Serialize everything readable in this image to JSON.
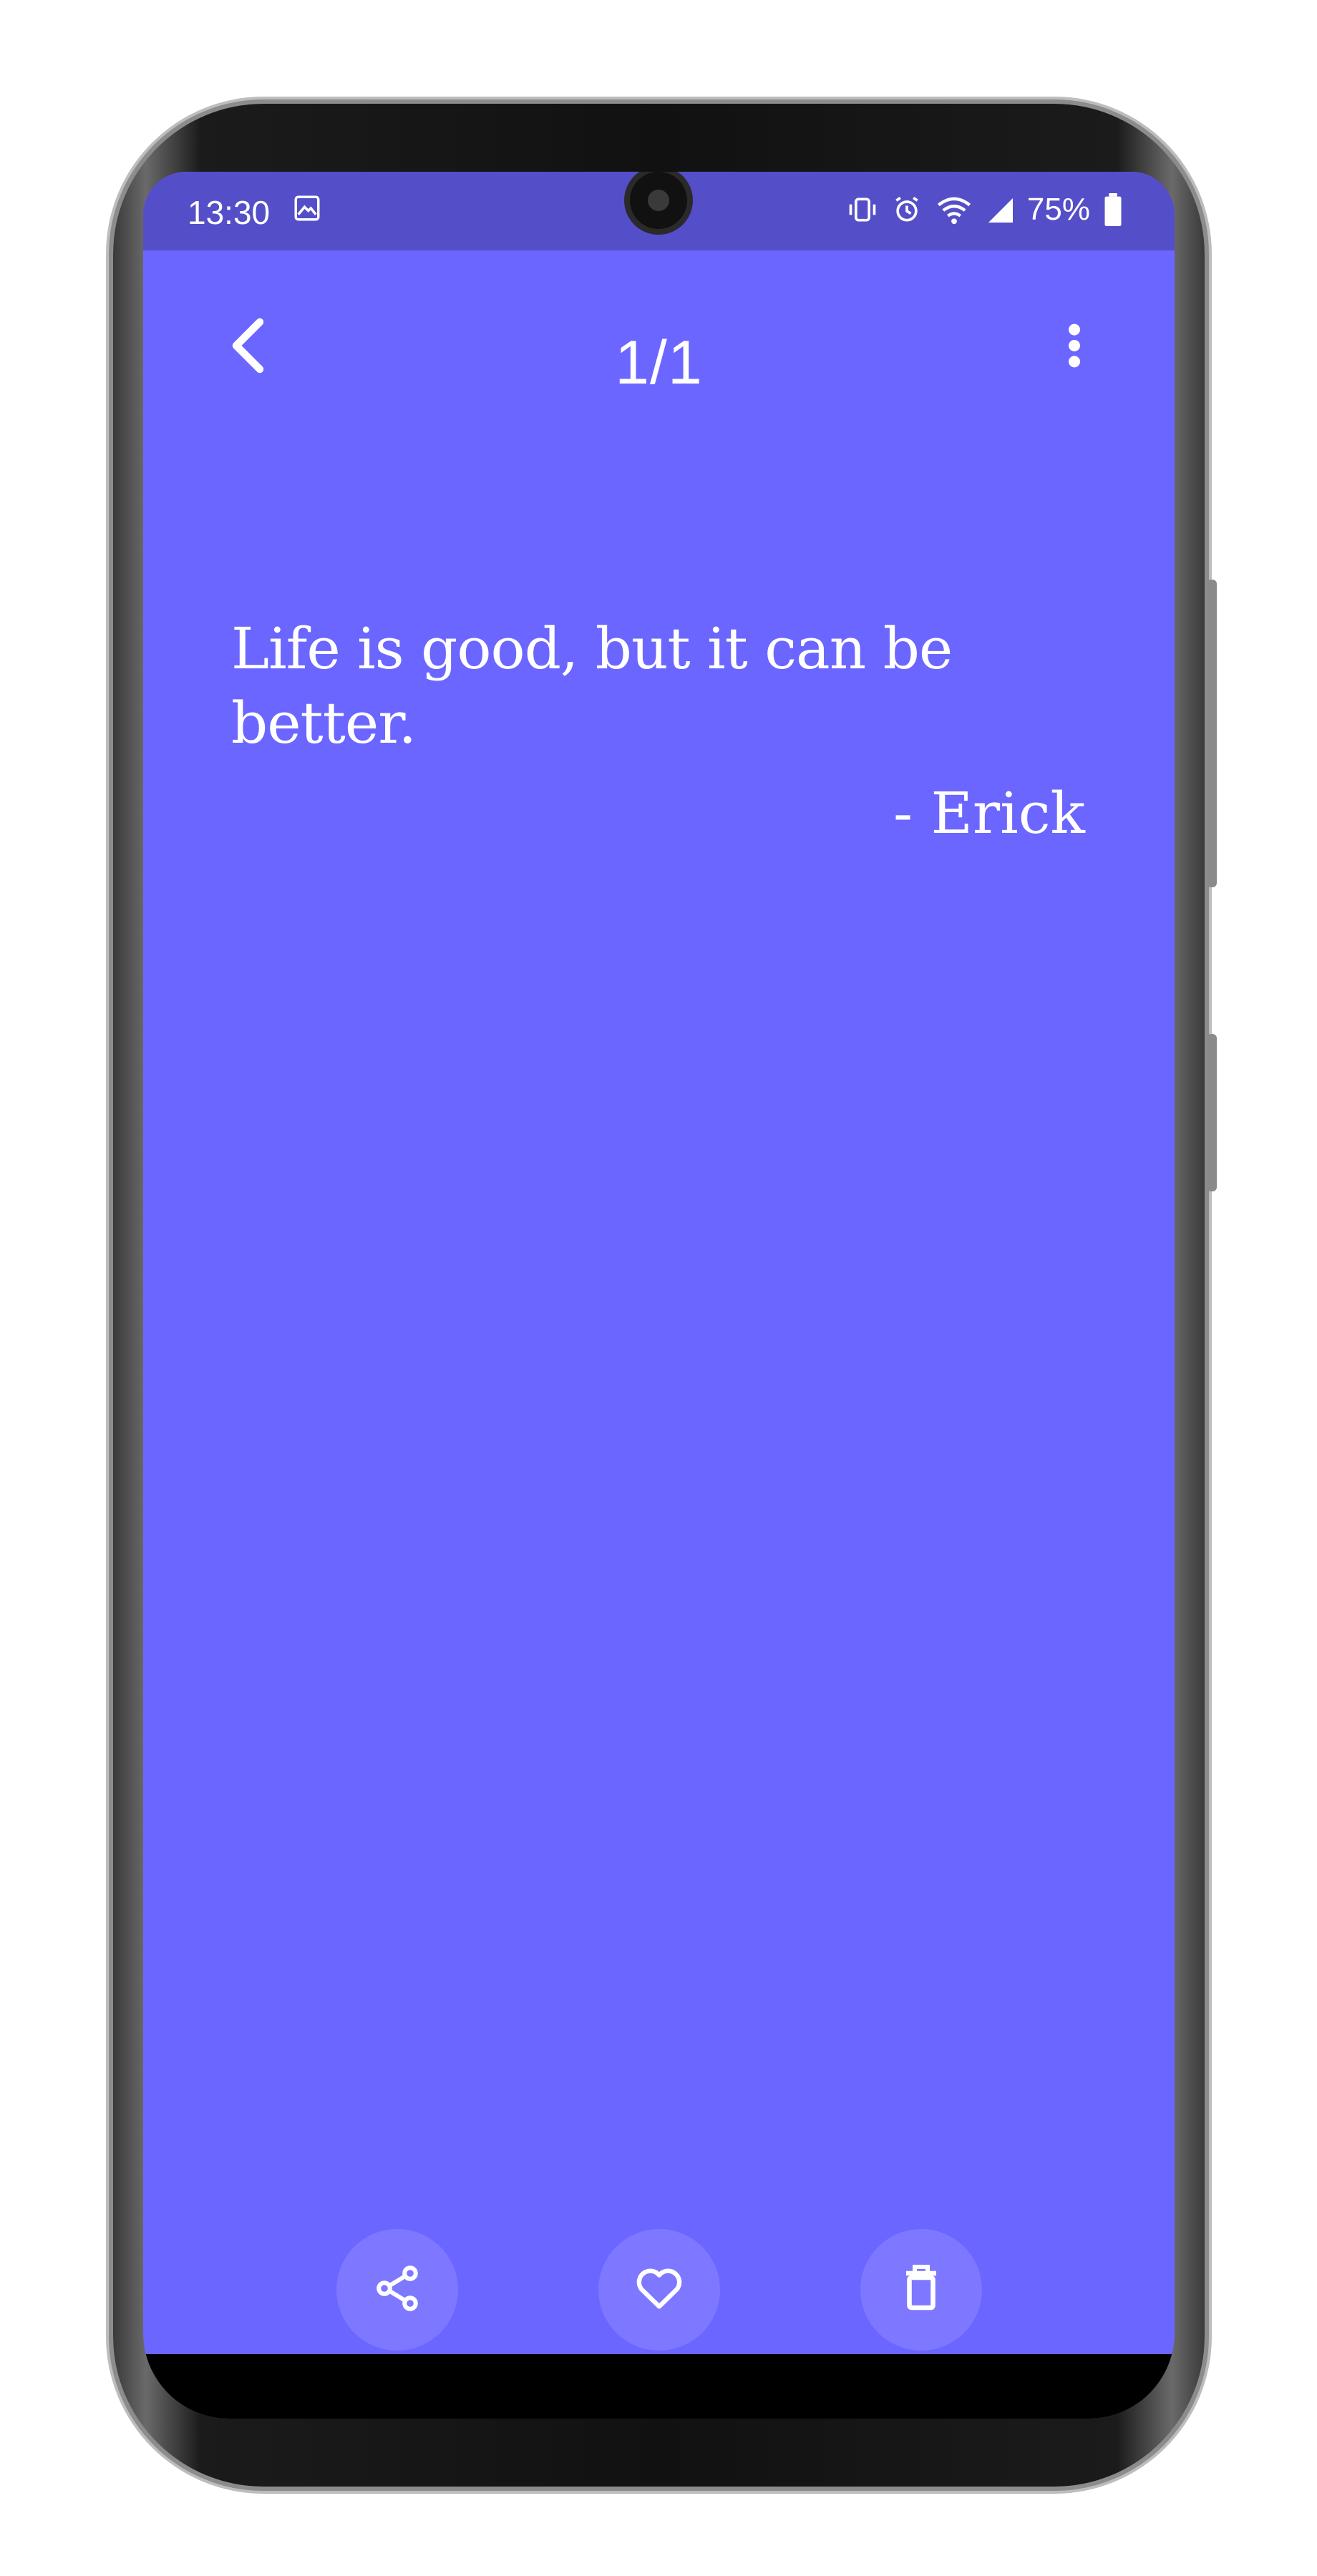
{
  "status_bar": {
    "time": "13:30",
    "battery": "75%",
    "icons": [
      "gallery-icon",
      "vibrate-icon",
      "alarm-icon",
      "wifi-icon",
      "signal-icon",
      "battery-icon"
    ],
    "color": "#554ec9"
  },
  "header": {
    "page_indicator": "1/1",
    "back_icon": "chevron-left-icon",
    "menu_icon": "more-vert-icon"
  },
  "quote": {
    "text": "Life is good, but it can be better.",
    "author": "- Erick"
  },
  "actions": [
    {
      "icon": "share-icon"
    },
    {
      "icon": "heart-icon"
    },
    {
      "icon": "trash-icon"
    }
  ],
  "colors": {
    "background": "#6b66ff",
    "status_bar": "#554ec9",
    "text": "#ffffff"
  }
}
